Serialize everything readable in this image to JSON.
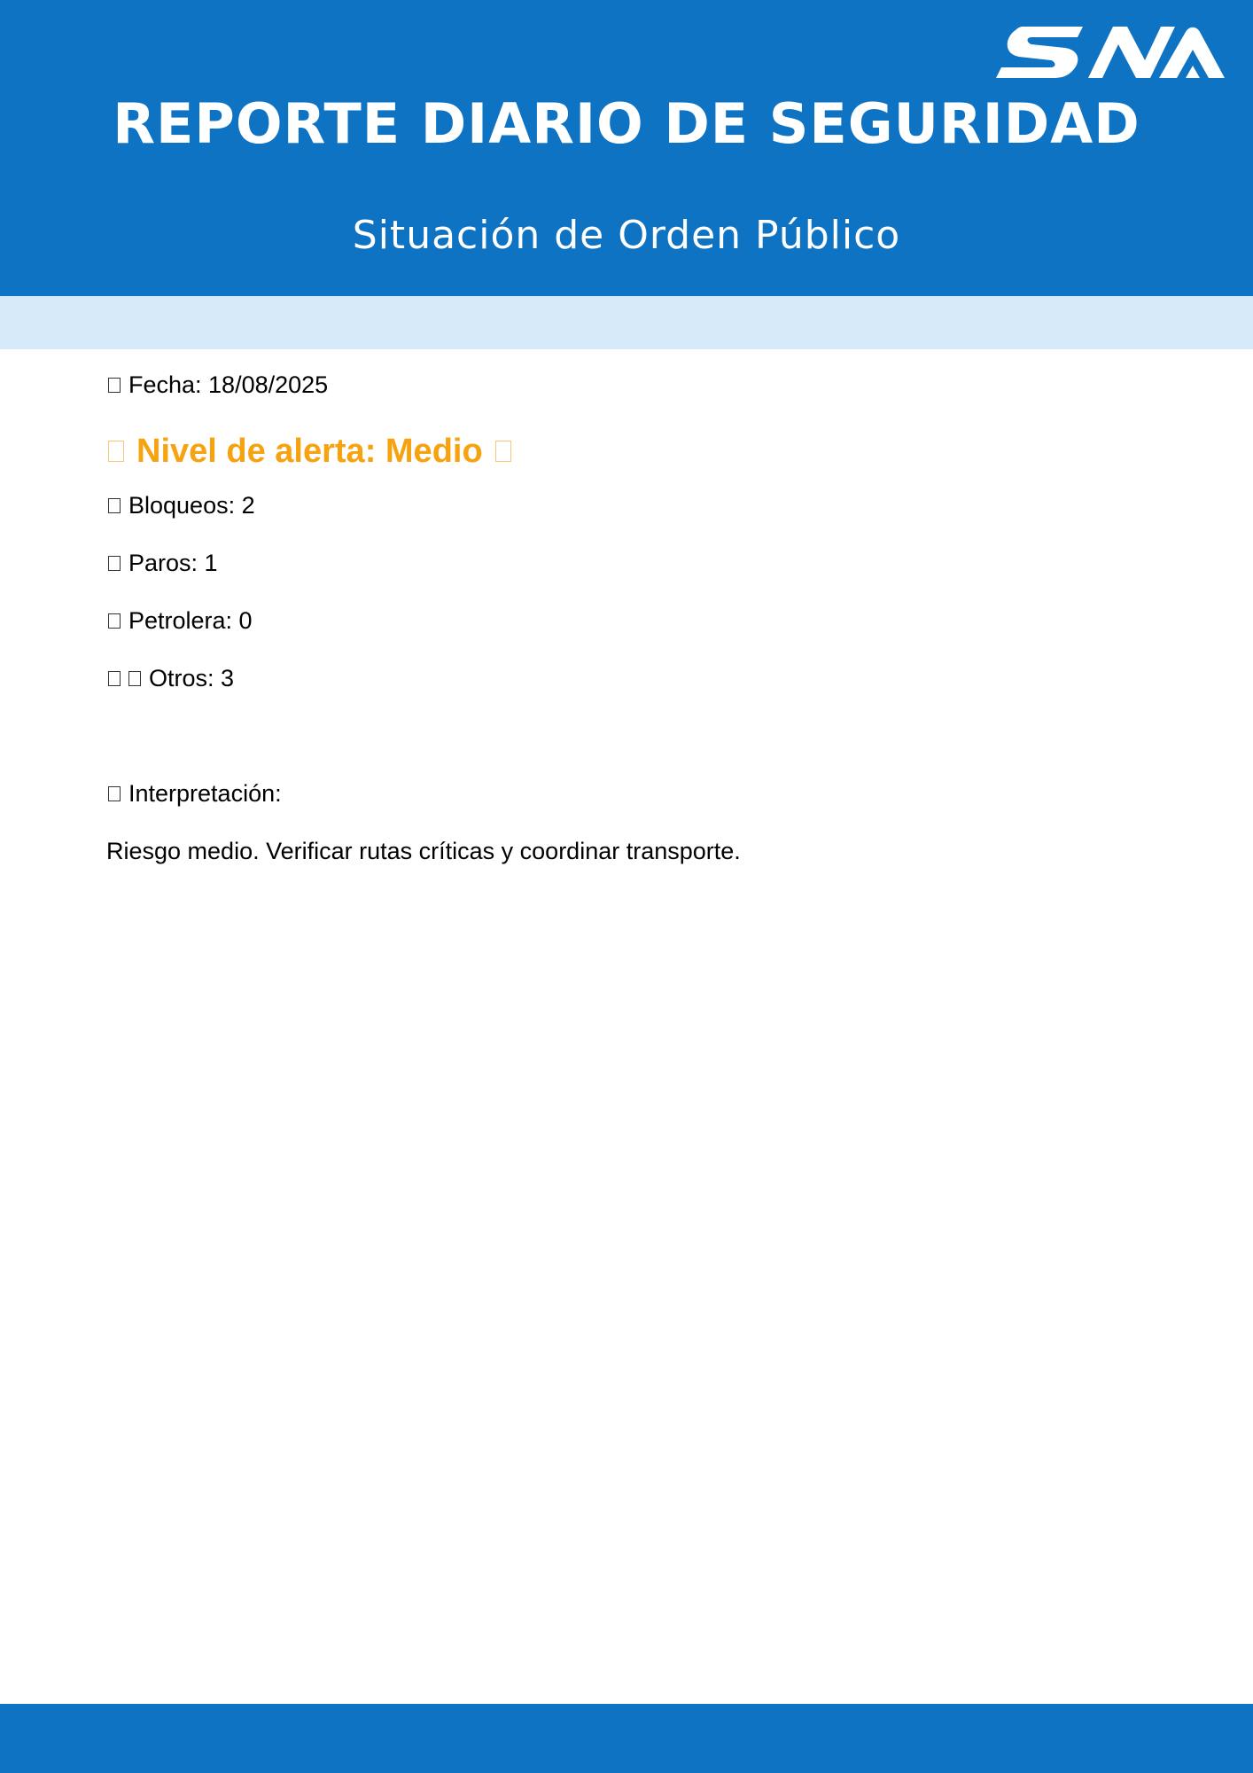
{
  "colors": {
    "header_blue": "#0f73c4",
    "band_light_blue": "#d6eaf9",
    "alert_orange": "#f7a20f"
  },
  "header": {
    "logo_text": "SNA",
    "title": "REPORTE DIARIO DE SEGURIDAD",
    "subtitle": "Situación de Orden Público"
  },
  "report": {
    "date": "Fecha: 18/08/2025",
    "alert_level": "Nivel de alerta: Medio",
    "stats": [
      {
        "icon": "missing-glyph-icon",
        "label": "Bloqueos: 2"
      },
      {
        "icon": "missing-glyph-icon",
        "label": "Paros: 1"
      },
      {
        "icon": "missing-glyph-icon",
        "label": "Petrolera: 0"
      },
      {
        "icon": "missing-glyph-icon",
        "label": "Otros: 3"
      }
    ],
    "interpretation_label": "Interpretación:",
    "interpretation_text": "Riesgo medio. Verificar rutas críticas y coordinar transporte."
  }
}
